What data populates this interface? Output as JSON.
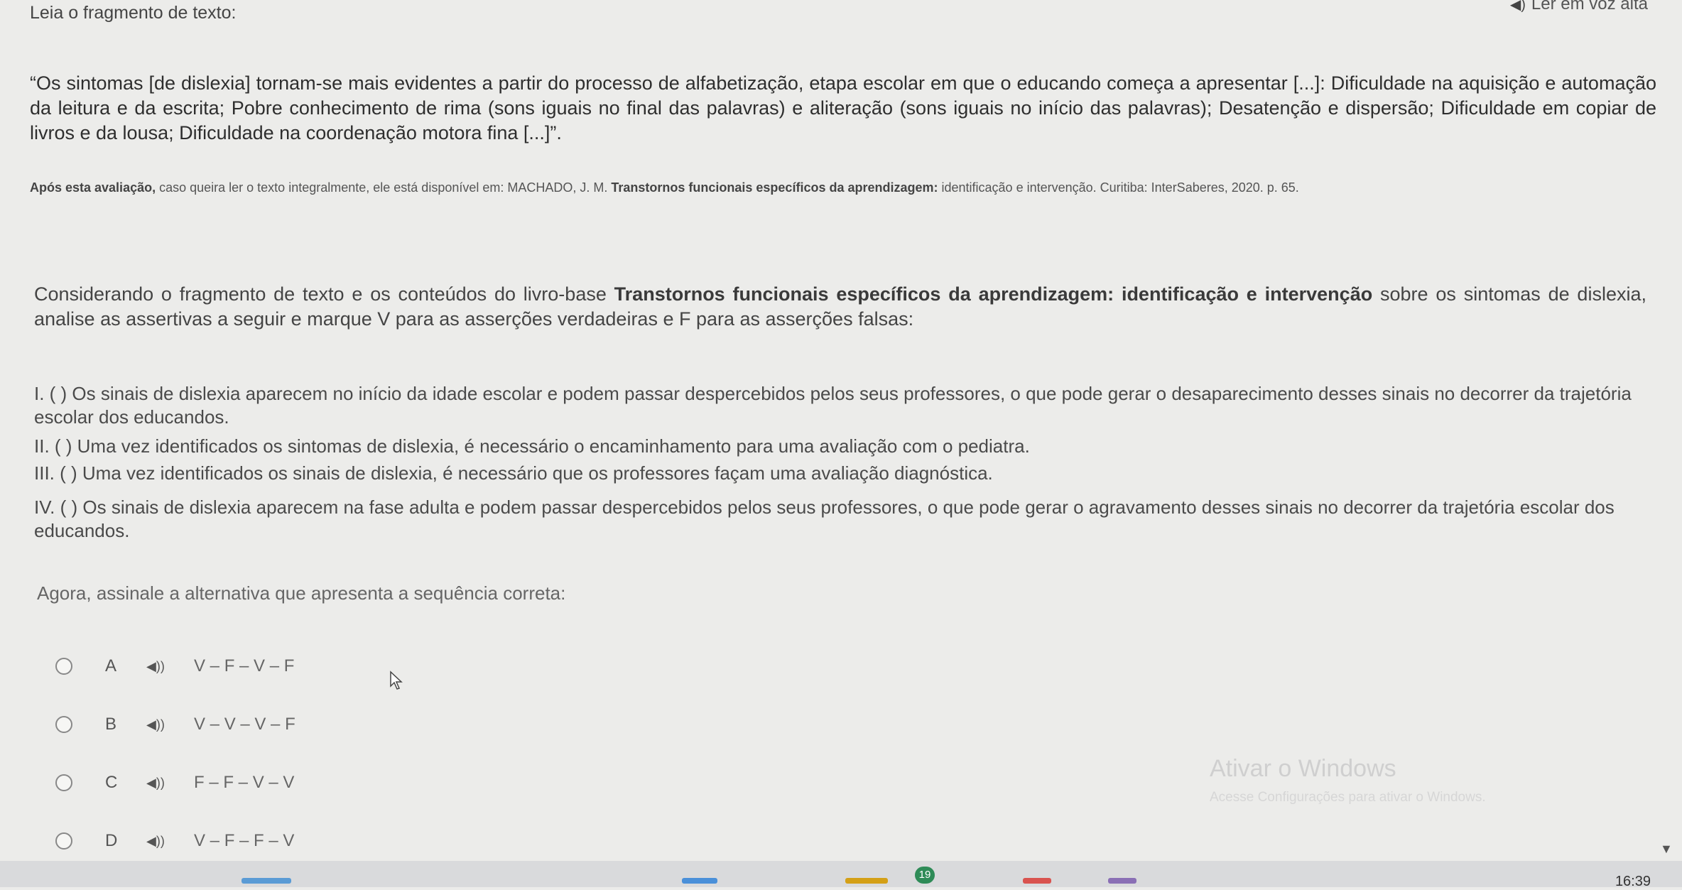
{
  "header": {
    "instruction": "Leia o fragmento de texto:",
    "read_aloud": "Ler em voz alta",
    "read_aloud_icon": "speaker-icon"
  },
  "fragment": {
    "quote": "“Os sintomas [de dislexia] tornam-se mais evidentes a partir do processo de alfabetização, etapa escolar em que o educando começa a apresentar [...]: Dificuldade na aquisição e automação da leitura e da escrita; Pobre conhecimento de rima (sons iguais no final das palavras) e aliteração (sons iguais no início das palavras); Desatenção e dispersão; Dificuldade em copiar de livros e da lousa; Dificuldade na coordenação motora fina [...]”.",
    "reference_lead": "Após esta avaliação,",
    "reference_mid": " caso queira ler o texto integralmente, ele está disponível em: MACHADO, J. M. ",
    "reference_book": "Transtornos funcionais específicos da aprendizagem:",
    "reference_tail": " identificação e intervenção. Curitiba: InterSaberes, 2020. p. 65."
  },
  "question": {
    "lead": "Considerando o fragmento de texto e os conteúdos do livro-base ",
    "book": "Transtornos funcionais específicos da aprendizagem: identificação e intervenção",
    "tail": " sobre os sintomas de dislexia, analise as assertivas a seguir e marque V para as asserções verdadeiras e F para as asserções falsas:"
  },
  "statements": [
    "I. ( ) Os sinais de dislexia aparecem no início da idade escolar e podem passar despercebidos pelos seus professores, o que pode gerar o desaparecimento desses sinais no decorrer da trajetória escolar dos educandos.",
    "II. ( ) Uma vez identificados os sintomas de dislexia, é necessário o encaminhamento para uma avaliação com o pediatra.",
    "III. ( ) Uma vez identificados os sinais de dislexia, é necessário que os professores façam uma avaliação diagnóstica.",
    "IV. ( ) Os sinais de dislexia aparecem na fase adulta e podem passar despercebidos pelos seus professores, o que pode gerar o agravamento desses sinais no decorrer da trajetória escolar dos educandos."
  ],
  "prompt": "Agora, assinale a alternativa que apresenta a sequência correta:",
  "options": [
    {
      "letter": "A",
      "sequence": "V – F – V – F"
    },
    {
      "letter": "B",
      "sequence": "V – V – V – F"
    },
    {
      "letter": "C",
      "sequence": "F – F – V – V"
    },
    {
      "letter": "D",
      "sequence": "V – F – F – V"
    }
  ],
  "watermark": {
    "title": "Ativar o Windows",
    "subtitle": "Acesse Configurações para ativar o Windows."
  },
  "taskbar": {
    "badge": "19",
    "clock": "16:39"
  }
}
